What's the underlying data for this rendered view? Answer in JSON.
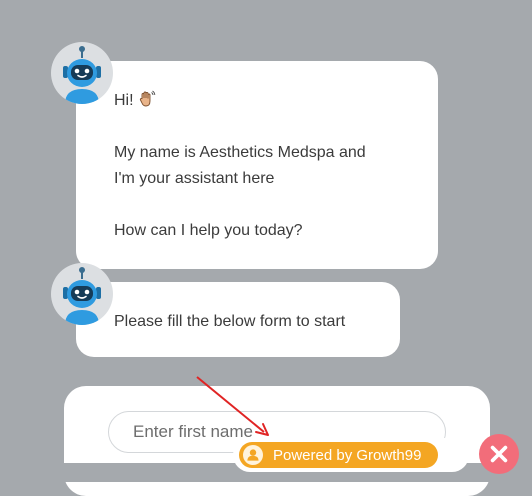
{
  "chat": {
    "messages": [
      {
        "greeting": "Hi!",
        "greeting_icon": "waving-hand-icon",
        "line1": "My name is Aesthetics Medspa and",
        "line2": "I'm your assistant here",
        "line3": "How can I help you today?"
      },
      {
        "line1": "Please fill the below form to start"
      }
    ],
    "avatar_icon": "robot-icon"
  },
  "form": {
    "first_name_placeholder": "Enter first name"
  },
  "footer": {
    "powered_by": "Powered by Growth99",
    "brand_color": "#f4a623",
    "close_icon": "close-icon",
    "close_color": "#f26d7a"
  },
  "annotation": {
    "arrow_color": "#e02424"
  }
}
